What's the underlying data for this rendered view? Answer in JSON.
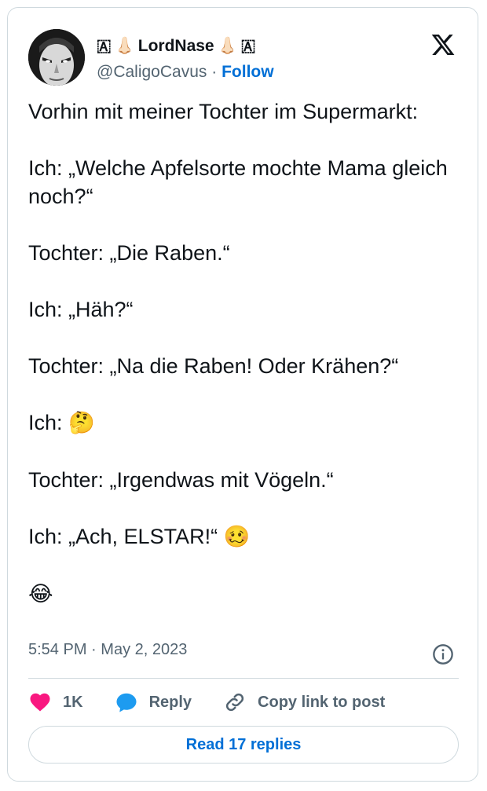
{
  "author": {
    "display_name_prefix": "🇦",
    "nose_emoji": "👃🏻",
    "display_name": "LordNase",
    "display_name_suffix": "🇦",
    "handle": "@CaligoCavus",
    "separator": "·",
    "follow_label": "Follow"
  },
  "tweet": {
    "paragraphs": [
      "Vorhin mit meiner Tochter im Supermarkt:",
      "Ich: „Welche Apfelsorte mochte Mama gleich noch?“",
      "Tochter: „Die Raben.“",
      "Ich: „Häh?“",
      "Tochter: „Na die Raben! Oder Krähen?“",
      "Ich:",
      "Tochter: „Irgendwas mit Vögeln.“",
      "Ich: „Ach, ELSTAR!“"
    ],
    "emoji_thinking": "🤔",
    "emoji_woozy": "🥴",
    "emoji_laughing": "😂"
  },
  "meta": {
    "time": "5:54 PM",
    "separator": "·",
    "date": "May 2, 2023"
  },
  "actions": {
    "like_count": "1K",
    "reply_label": "Reply",
    "copy_label": "Copy link to post"
  },
  "read_replies_label": "Read 17 replies",
  "colors": {
    "like": "#f91880",
    "reply": "#1d9bf0",
    "link": "#006fd6",
    "muted": "#536471",
    "border": "#cfd9de"
  }
}
